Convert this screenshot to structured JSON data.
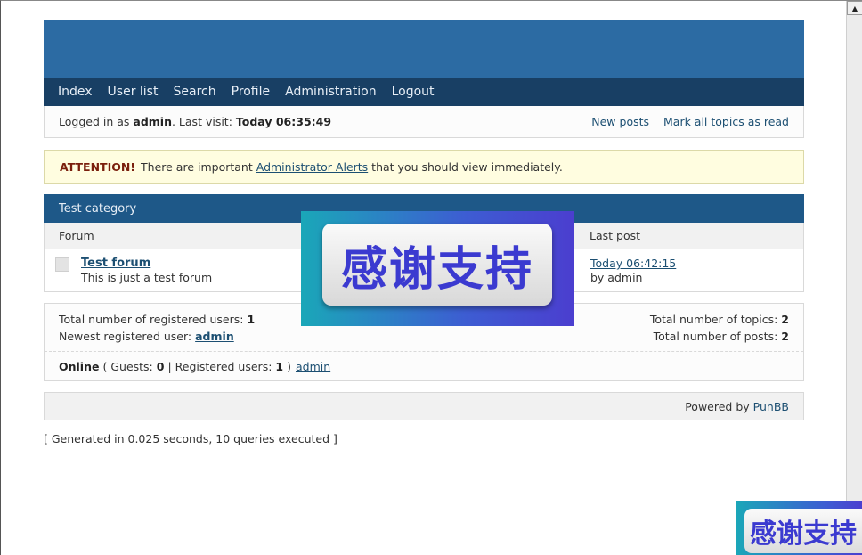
{
  "nav": {
    "items": [
      "Index",
      "User list",
      "Search",
      "Profile",
      "Administration",
      "Logout"
    ]
  },
  "status": {
    "logged_in_prefix": "Logged in as",
    "username": "admin",
    "last_visit_prefix": ". Last visit:",
    "last_visit": "Today 06:35:49",
    "new_posts": "New posts",
    "mark_read": "Mark all topics as read"
  },
  "alert": {
    "label": "ATTENTION!",
    "text_before": "There are important",
    "link": "Administrator Alerts",
    "text_after": "that you should view immediately."
  },
  "category": {
    "title": "Test category",
    "col_forum": "Forum",
    "col_last_post": "Last post",
    "forums": [
      {
        "name": "Test forum",
        "description": "This is just a test forum",
        "last_post_time": "Today 06:42:15",
        "last_post_by": "by admin"
      }
    ]
  },
  "stats": {
    "registered_label": "Total number of registered users:",
    "registered_value": "1",
    "newest_label": "Newest registered user:",
    "newest_value": "admin",
    "topics_label": "Total number of topics:",
    "topics_value": "2",
    "posts_label": "Total number of posts:",
    "posts_value": "2",
    "online_label": "Online",
    "guests_label": "( Guests:",
    "guests_value": "0",
    "registered_online_label": "| Registered users:",
    "registered_online_value": "1",
    "close_paren": ")",
    "online_user": "admin"
  },
  "footer": {
    "powered_by": "Powered by",
    "punbb": "PunBB"
  },
  "generated": "[ Generated in 0.025 seconds, 10 queries executed ]",
  "overlay": {
    "banner_text": "感谢支持",
    "banner_small_text": "感谢支持"
  },
  "colors": {
    "header": "#2c6ba3",
    "navbar": "#183f64",
    "category_header": "#1e5888",
    "alert_bg": "#fffde0",
    "link": "#1c4f72"
  },
  "icons": [
    "forum-status-icon",
    "scroll-up-arrow-icon"
  ]
}
